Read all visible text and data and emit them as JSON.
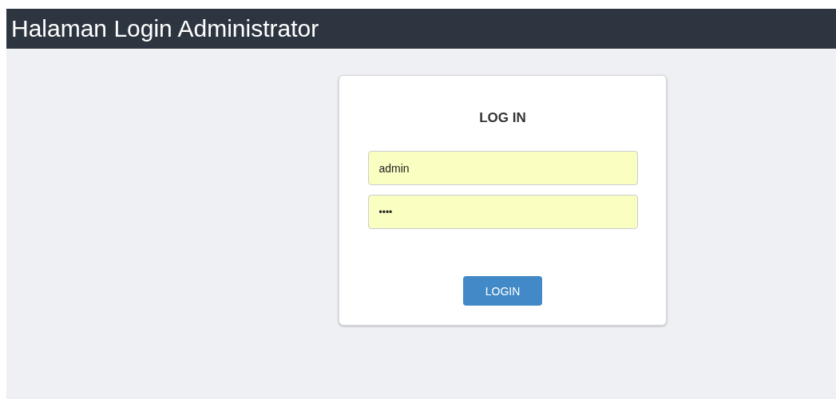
{
  "header": {
    "title": "Halaman Login Administrator"
  },
  "login_card": {
    "title": "LOG IN",
    "fields": [
      {
        "kind": "text",
        "value": "admin"
      },
      {
        "kind": "password",
        "value": "••••"
      }
    ],
    "button": "LOGIN"
  }
}
